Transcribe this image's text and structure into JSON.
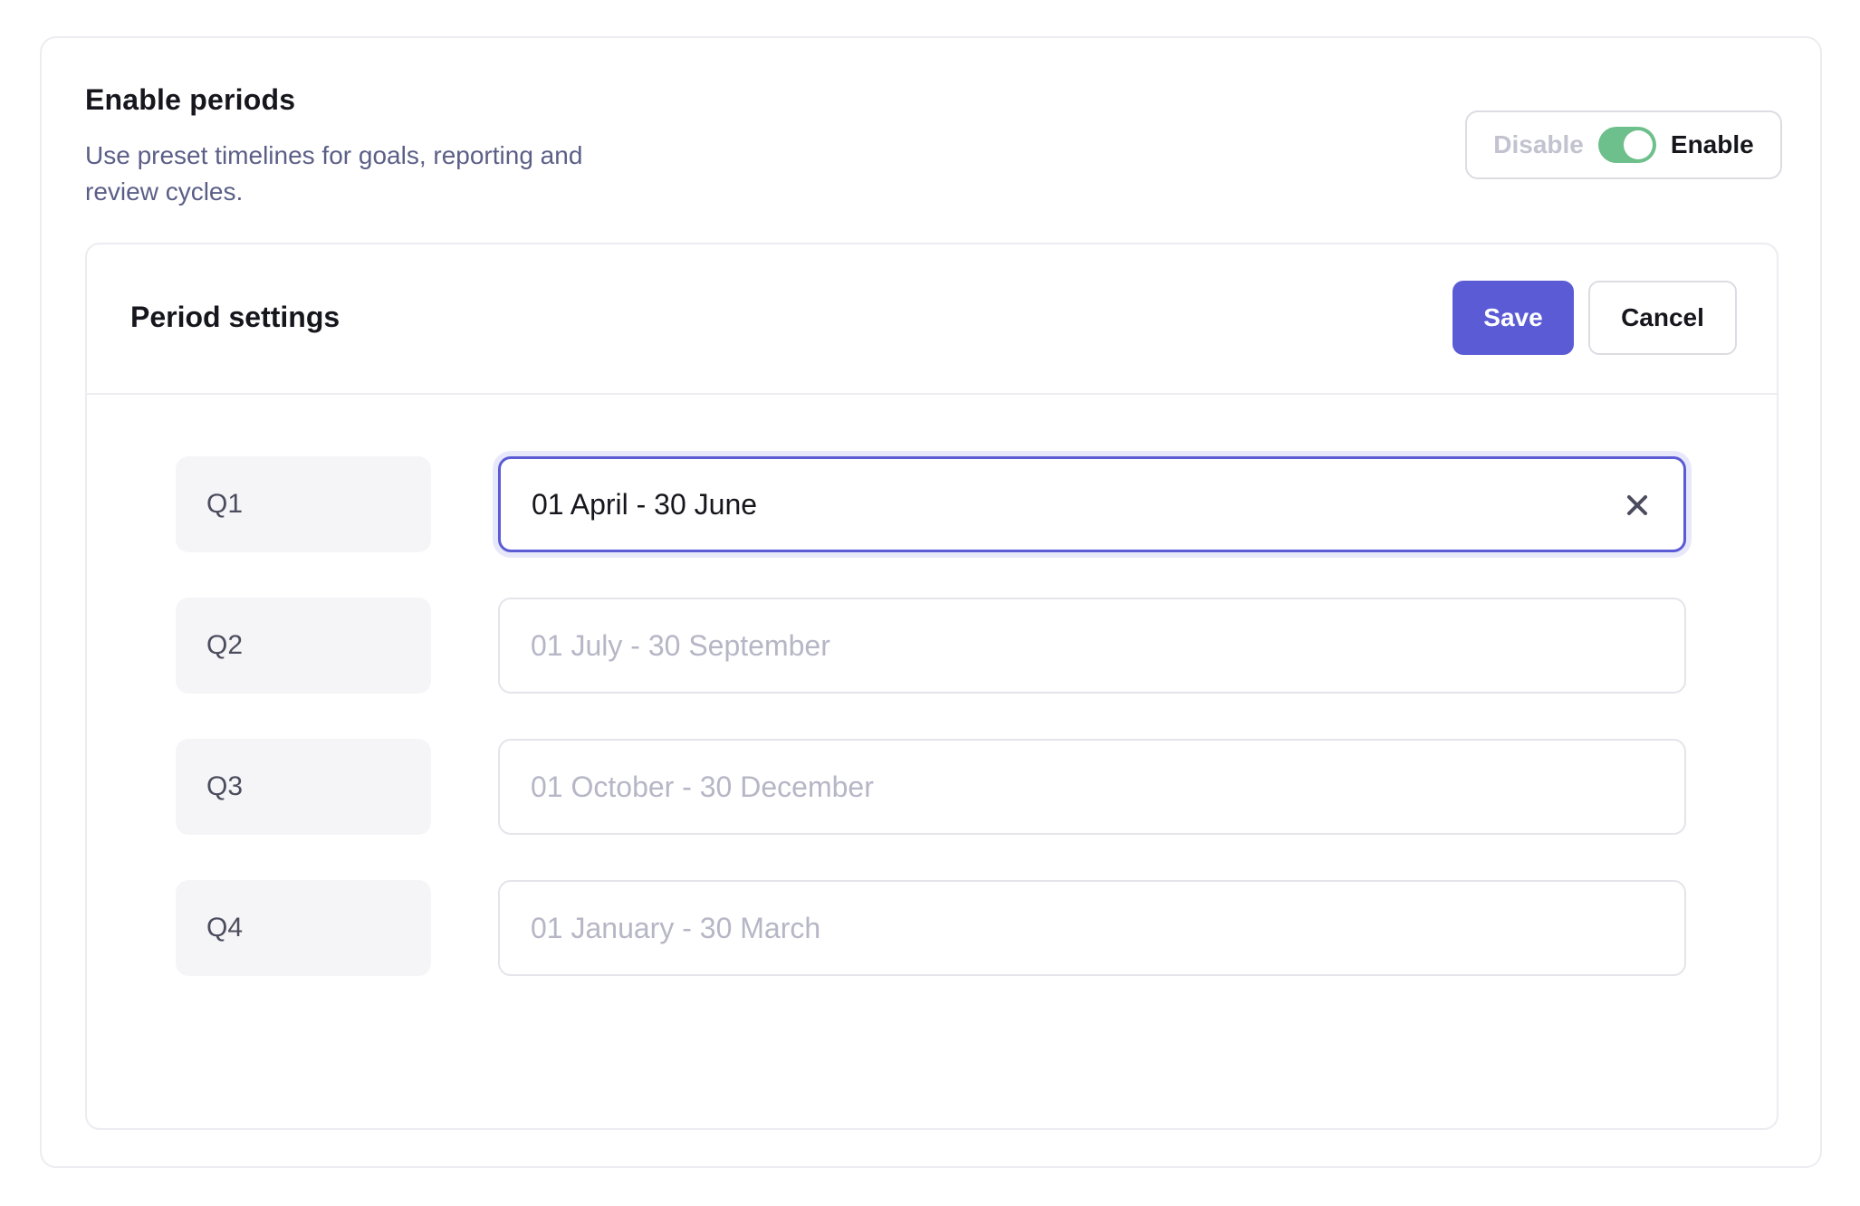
{
  "header": {
    "title": "Enable periods",
    "description": "Use preset timelines for goals, reporting and review cycles."
  },
  "toggle": {
    "off_label": "Disable",
    "on_label": "Enable",
    "state": "enabled",
    "on_color": "#6dbf8b"
  },
  "period_settings": {
    "title": "Period settings",
    "save_label": "Save",
    "cancel_label": "Cancel",
    "accent_color": "#5b5bd6",
    "periods": [
      {
        "label": "Q1",
        "value": "01 April - 30 June",
        "placeholder": ""
      },
      {
        "label": "Q2",
        "value": "",
        "placeholder": "01 July - 30 September"
      },
      {
        "label": "Q3",
        "value": "",
        "placeholder": "01 October - 30 December"
      },
      {
        "label": "Q4",
        "value": "",
        "placeholder": "01 January - 30 March"
      }
    ]
  },
  "icons": {
    "clear": "close-icon"
  }
}
